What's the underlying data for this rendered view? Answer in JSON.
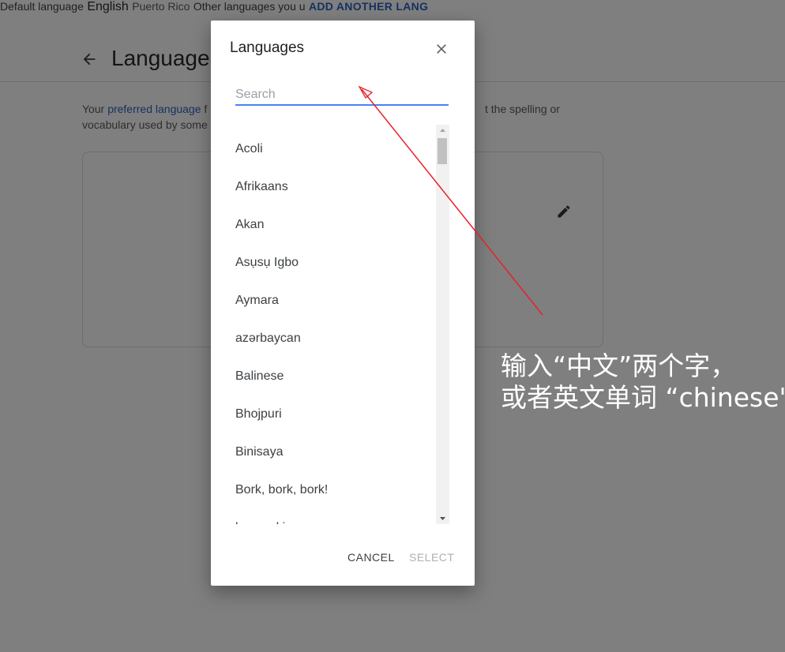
{
  "background_page": {
    "title": "Language",
    "intro_line1_prefix": "Your ",
    "intro_link": "preferred language",
    "intro_line1_suffix": " f",
    "intro_line1_tail": "t the spelling or",
    "intro_line2": "vocabulary used by some",
    "default_language_label": "Default language",
    "default_language_name": "English",
    "default_language_region": "Puerto Rico",
    "other_languages_label": "Other languages you u",
    "add_another_label": "ADD ANOTHER LANG"
  },
  "dialog": {
    "title": "Languages",
    "search_placeholder": "Search",
    "languages": [
      "Acoli",
      "Afrikaans",
      "Akan",
      "Asụsụ Igbo",
      "Aymara",
      "azərbaycan",
      "Balinese",
      "Bhojpuri",
      "Binisaya",
      "Bork, bork, bork!",
      "bosanski"
    ],
    "cancel_label": "CANCEL",
    "select_label": "SELECT"
  },
  "annotation": {
    "line1": "输入“中文”两个字，",
    "line2": "或者英文单词 “chinese\""
  },
  "colors": {
    "accent": "#4285f4",
    "link": "#1a73e8",
    "annotation_arrow": "#e8202a",
    "overlay": "#7f7f7f"
  }
}
